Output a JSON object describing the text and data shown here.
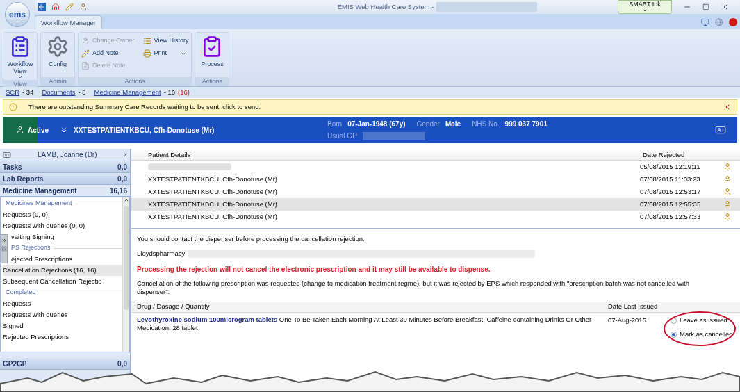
{
  "window": {
    "logo": "ems",
    "title": "EMIS Web Health Care System -",
    "smart_ink": "SMART Ink"
  },
  "ribbon": {
    "tab": "Workflow Manager",
    "groups": [
      {
        "label": "View",
        "items": [
          {
            "label": "Workflow View",
            "disabled": false,
            "dropdown": true
          }
        ]
      },
      {
        "label": "Admin",
        "items": [
          {
            "label": "Config",
            "disabled": false,
            "dropdown": false
          }
        ]
      },
      {
        "label": "Actions",
        "items": [
          {
            "label": "Change Owner",
            "disabled": true,
            "dropdown": false
          },
          {
            "label": "Add Note",
            "disabled": false,
            "dropdown": false
          },
          {
            "label": "Delete Note",
            "disabled": true,
            "dropdown": false
          },
          {
            "label": "View History",
            "disabled": false,
            "dropdown": false
          },
          {
            "label": "Print",
            "disabled": false,
            "dropdown": true
          }
        ]
      },
      {
        "label": "Actions",
        "items": [
          {
            "label": "Process",
            "disabled": false,
            "dropdown": false
          }
        ]
      }
    ]
  },
  "links": [
    {
      "label": "SCR",
      "count": "- 34"
    },
    {
      "label": "Documents",
      "count": "- 8"
    },
    {
      "label": "Medicine Management",
      "count": "- 16",
      "alert": "(16)"
    }
  ],
  "notice": {
    "text": "There are outstanding Summary Care Records waiting to be sent, click to send."
  },
  "patient": {
    "status": "Active",
    "name": "XXTESTPATIENTKBCU,  Cfh-Donotuse (Mr)",
    "born_label": "Born",
    "born": "07-Jan-1948 (67y)",
    "gender_label": "Gender",
    "gender": "Male",
    "nhs_label": "NHS No.",
    "nhs": "999 037 7901",
    "gp_label": "Usual GP"
  },
  "sidebar": {
    "user": "LAMB, Joanne (Dr)",
    "collapse": "«",
    "sections": [
      {
        "label": "Tasks",
        "count": "0,0",
        "expanded": false
      },
      {
        "label": "Lab Reports",
        "count": "0,0",
        "expanded": false
      },
      {
        "label": "Medicine Management",
        "count": "16,16",
        "expanded": true
      }
    ],
    "tree": [
      {
        "heading": "Medicines Management",
        "items": [
          {
            "label": "Requests (0, 0)",
            "selected": false
          },
          {
            "label": "Requests with queries (0, 0)",
            "selected": false
          },
          {
            "label": "vaiting Signing",
            "selected": false
          }
        ]
      },
      {
        "heading": "PS Rejections",
        "items": [
          {
            "label": "ejected Prescriptions",
            "selected": false
          },
          {
            "label": "Cancellation Rejections (16, 16)",
            "selected": true
          },
          {
            "label": "Subsequent Cancellation Rejectio",
            "selected": false
          }
        ]
      },
      {
        "heading": "Completed",
        "items": [
          {
            "label": "Requests",
            "selected": false
          },
          {
            "label": "Requests with queries",
            "selected": false
          },
          {
            "label": "Signed",
            "selected": false
          },
          {
            "label": "Rejected Prescriptions",
            "selected": false
          }
        ]
      }
    ],
    "after": [
      {
        "label": "GP2GP",
        "count": "0,0",
        "expanded": false
      }
    ]
  },
  "table": {
    "columns": [
      "Patient Details",
      "Date Rejected"
    ],
    "rows": [
      {
        "redacted": true,
        "patient": "",
        "date": "05/08/2015 12:19:11",
        "selected": false
      },
      {
        "redacted": false,
        "patient": "XXTESTPATIENTKBCU, Cfh-Donotuse (Mr)",
        "date": "07/08/2015 11:03:23",
        "selected": false
      },
      {
        "redacted": false,
        "patient": "XXTESTPATIENTKBCU, Cfh-Donotuse (Mr)",
        "date": "07/08/2015 12:53:17",
        "selected": false
      },
      {
        "redacted": false,
        "patient": "XXTESTPATIENTKBCU, Cfh-Donotuse (Mr)",
        "date": "07/08/2015 12:55:35",
        "selected": true
      },
      {
        "redacted": false,
        "patient": "XXTESTPATIENTKBCU, Cfh-Donotuse (Mr)",
        "date": "07/08/2015 12:57:33",
        "selected": false
      }
    ]
  },
  "detail": {
    "instruction": "You should contact the dispenser before processing the cancellation rejection.",
    "dispenser": "Lloydspharmacy",
    "warning": "Processing the rejection will not cancel the electronic prescription and it may still be available to dispense.",
    "explanation": "Cancellation of the following prescription was requested (change to medication treatment regme), but it was rejected by EPS which responded with \"prescription batch was not cancelled with dispenser\".",
    "drug_table": {
      "columns": [
        "Drug / Dosage / Quantity",
        "Date Last Issued"
      ],
      "drug": "Levothyroxine sodium 100microgram tablets",
      "dosage": "One To Be Taken Each Morning At Least 30 Minutes Before Breakfast, Caffeine-containing Drinks Or Other Medication, 28 tablet",
      "date": "07-Aug-2015",
      "options": [
        {
          "label": "Leave as issued",
          "selected": false
        },
        {
          "label": "Mark as cancelled",
          "selected": true
        }
      ]
    }
  }
}
